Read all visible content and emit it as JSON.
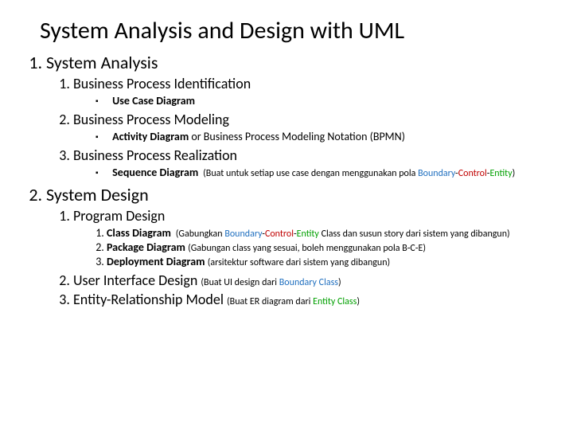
{
  "title": "System Analysis and Design with UML",
  "sections": [
    {
      "label": "System Analysis",
      "items": [
        {
          "label": "Business Process Identification",
          "bullets": [
            {
              "strong": "Use Case Diagram",
              "rest": ""
            }
          ]
        },
        {
          "label": "Business Process Modeling",
          "bullets": [
            {
              "strong": "Activity Diagram",
              "rest": " or Business Process Modeling Notation (BPMN)"
            }
          ]
        },
        {
          "label": "Business Process Realization",
          "bullets": [
            {
              "strong": "Sequence Diagram",
              "paren_pre": "(Buat untuk setiap use case dengan menggunakan pola ",
              "bce": true,
              "paren_post": ")"
            }
          ]
        }
      ]
    },
    {
      "label": "System Design",
      "items": [
        {
          "label": "Program Design",
          "numbered": [
            {
              "strong": "Class Diagram",
              "paren_pre": "(Gabungkan ",
              "bce": true,
              "paren_mid": " Class dan susun story dari sistem yang dibangun)"
            },
            {
              "strong": "Package Diagram",
              "paren_plain": "(Gabungan class yang sesuai, boleh menggunakan pola B-C-E)"
            },
            {
              "strong": "Deployment Diagram",
              "paren_plain": "(arsitektur software dari sistem yang dibangun)"
            }
          ]
        },
        {
          "label": "User Interface Design",
          "inline_paren_pre": "(Buat UI design dari ",
          "inline_link": "Boundary Class",
          "inline_link_class": "c-boundary",
          "inline_paren_post": ")"
        },
        {
          "label": "Entity-Relationship Model",
          "inline_paren_pre": "(Buat ER diagram dari ",
          "inline_link": "Entity Class",
          "inline_link_class": "c-entity",
          "inline_paren_post": ")"
        }
      ]
    }
  ],
  "bce": {
    "b": "Boundary",
    "c": "Control",
    "e": "Entity",
    "sep": "-"
  }
}
